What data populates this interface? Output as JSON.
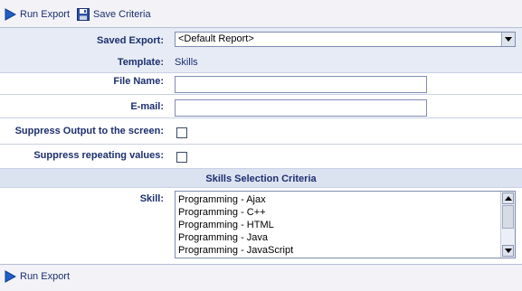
{
  "toolbar": {
    "run_export_label": "Run Export",
    "save_criteria_label": "Save Criteria"
  },
  "form": {
    "saved_export": {
      "label": "Saved Export:",
      "value": "<Default Report>"
    },
    "template": {
      "label": "Template:",
      "value": "Skills"
    },
    "file_name": {
      "label": "File Name:",
      "value": ""
    },
    "email": {
      "label": "E-mail:",
      "value": ""
    },
    "suppress_output": {
      "label": "Suppress Output to the screen:",
      "checked": false
    },
    "suppress_repeating": {
      "label": "Suppress repeating values:",
      "checked": false
    }
  },
  "criteria": {
    "section_title": "Skills Selection Criteria",
    "skill_label": "Skill:",
    "skills": [
      "Programming - Ajax",
      "Programming - C++",
      "Programming - HTML",
      "Programming - Java",
      "Programming - JavaScript"
    ]
  },
  "footer": {
    "run_export_label": "Run Export"
  },
  "colors": {
    "text": "#1c2f6e",
    "run_icon": "#1f5fc7",
    "shaded_row": "#e6ebf5"
  }
}
